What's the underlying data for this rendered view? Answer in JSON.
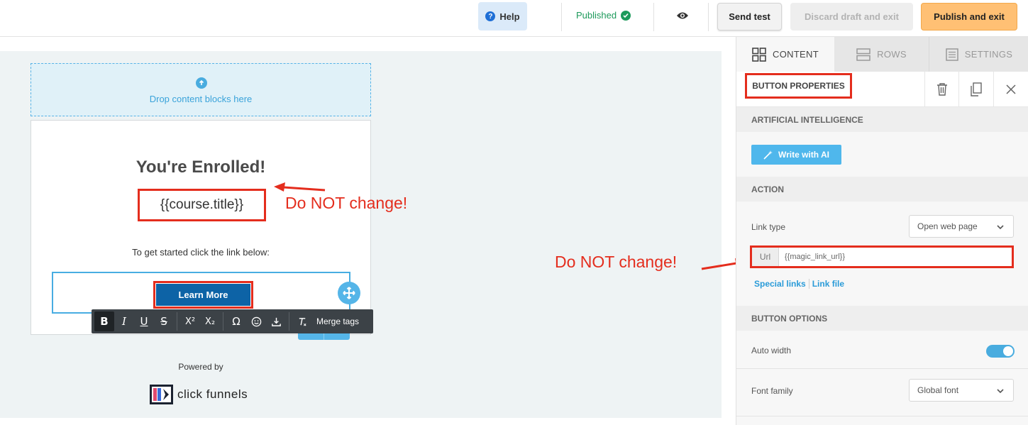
{
  "topbar": {
    "help_label": "Help",
    "status_label": "Published",
    "send_test_label": "Send test",
    "discard_label": "Discard draft and exit",
    "publish_label": "Publish and exit"
  },
  "canvas": {
    "dropzone_text": "Drop content blocks here",
    "email_title": "You're Enrolled!",
    "course_title_tag": "{{course.title}}",
    "body_text": "To get started click the link below:",
    "button_label": "Learn More",
    "powered_by": "Powered by",
    "logo_text": "click funnels"
  },
  "toolbar": {
    "bold": "B",
    "italic": "I",
    "underline": "U",
    "strike": "S",
    "superscript": "X²",
    "subscript": "X₂",
    "omega": "Ω",
    "merge_tags": "Merge tags"
  },
  "annotations": {
    "note_left": "Do NOT change!",
    "note_right": "Do NOT change!"
  },
  "panel": {
    "tabs": [
      {
        "label": "CONTENT"
      },
      {
        "label": "ROWS"
      },
      {
        "label": "SETTINGS"
      }
    ],
    "header_title": "BUTTON PROPERTIES",
    "ai_section": "ARTIFICIAL INTELLIGENCE",
    "ai_button": "Write with AI",
    "action_section": "ACTION",
    "link_type_label": "Link type",
    "link_type_value": "Open web page",
    "url_prefix": "Url",
    "url_value": "{{magic_link_url}}",
    "special_links": "Special links",
    "link_file": "Link file",
    "button_options_section": "BUTTON OPTIONS",
    "auto_width_label": "Auto width",
    "auto_width_on": true,
    "font_family_label": "Font family",
    "font_family_value": "Global font"
  },
  "colors": {
    "accent_blue": "#49acdf",
    "annotation_red": "#e42d1d",
    "publish_orange": "#ffc074",
    "button_blue": "#0d63a6",
    "published_green": "#1d9a5b"
  }
}
